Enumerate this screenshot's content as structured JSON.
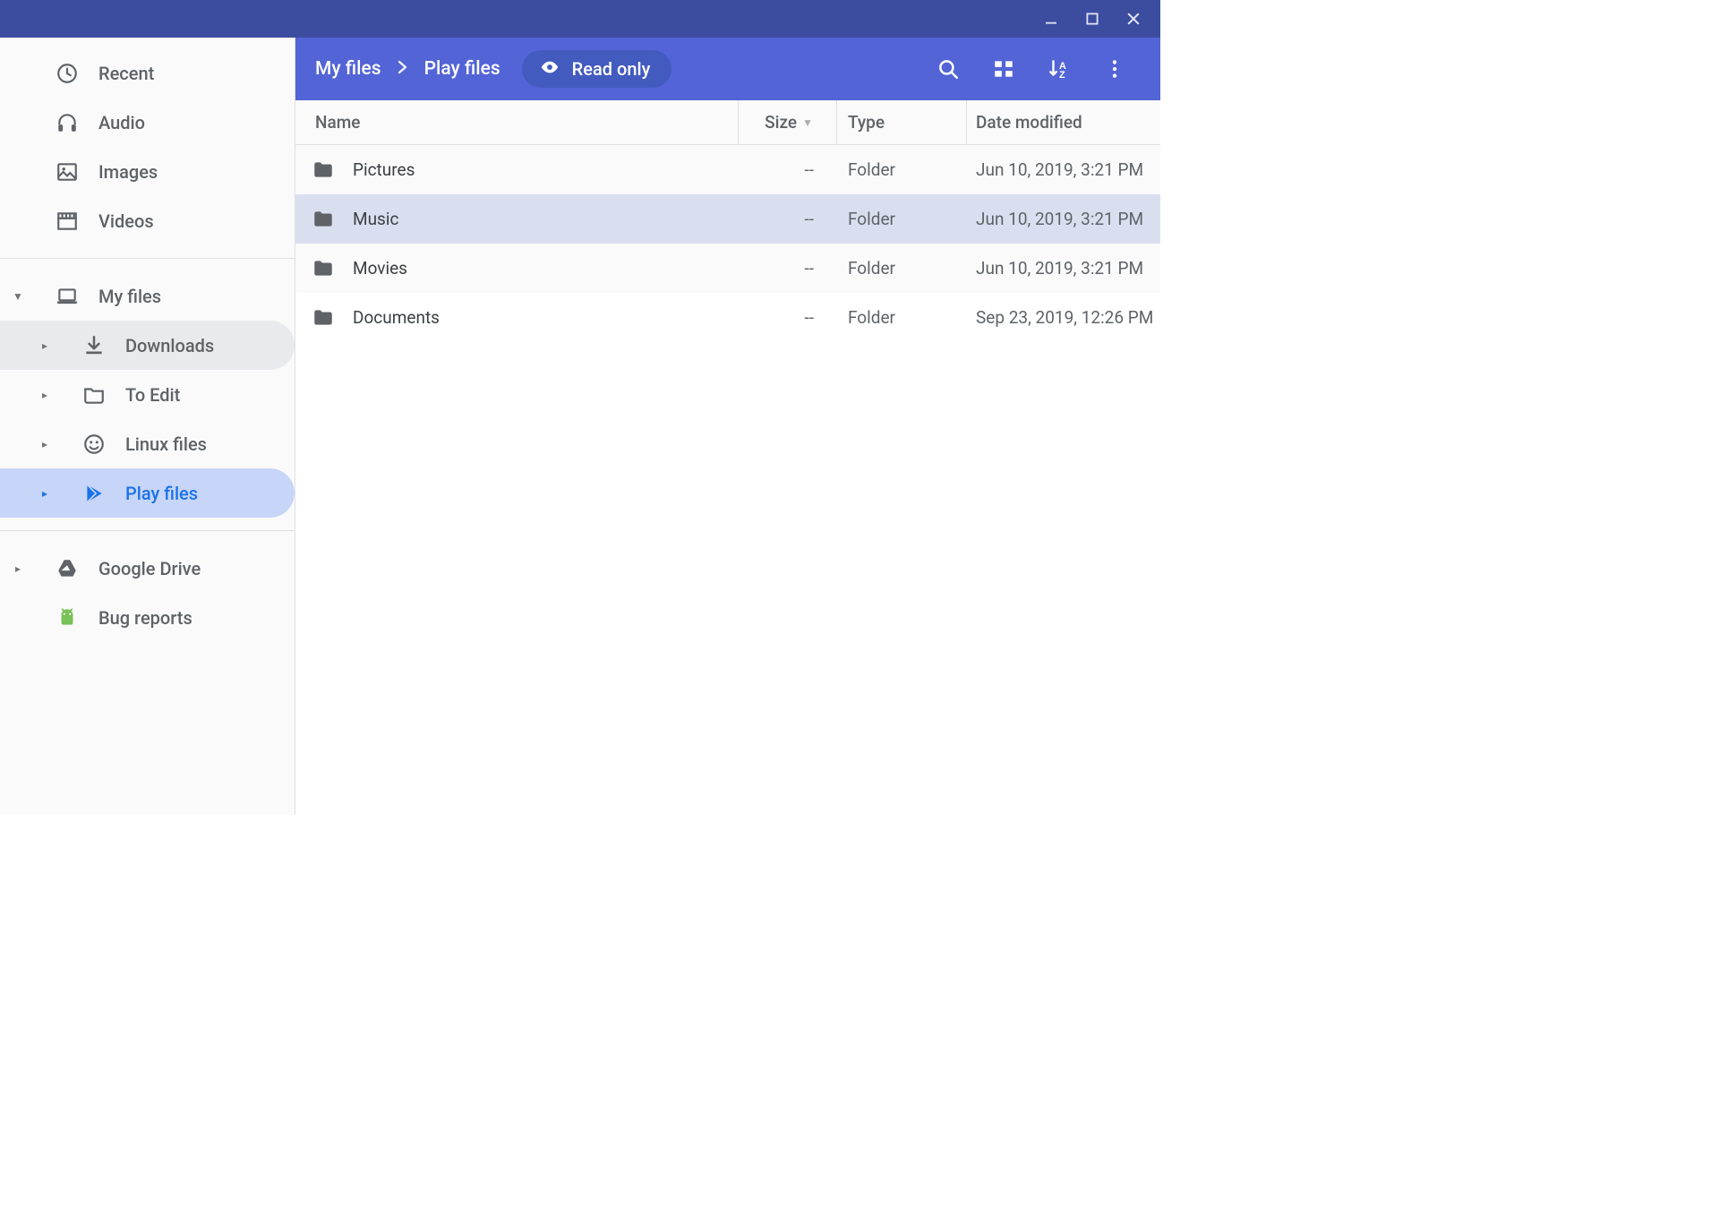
{
  "sidebar": {
    "quick": [
      {
        "id": "recent",
        "label": "Recent",
        "icon": "clock"
      },
      {
        "id": "audio",
        "label": "Audio",
        "icon": "headphones"
      },
      {
        "id": "images",
        "label": "Images",
        "icon": "image"
      },
      {
        "id": "videos",
        "label": "Videos",
        "icon": "clapper"
      }
    ],
    "myfiles": {
      "label": "My files",
      "children": [
        {
          "id": "downloads",
          "label": "Downloads",
          "icon": "download",
          "highlight": "light"
        },
        {
          "id": "to-edit",
          "label": "To Edit",
          "icon": "folder"
        },
        {
          "id": "linux",
          "label": "Linux files",
          "icon": "linux"
        },
        {
          "id": "play",
          "label": "Play files",
          "icon": "play",
          "highlight": "active"
        }
      ]
    },
    "drive": {
      "label": "Google Drive"
    },
    "bug": {
      "label": "Bug reports"
    }
  },
  "toolbar": {
    "crumbs": [
      "My files",
      "Play files"
    ],
    "readonly_label": "Read only"
  },
  "columns": {
    "name": "Name",
    "size": "Size",
    "type": "Type",
    "date": "Date modified"
  },
  "files": [
    {
      "name": "Pictures",
      "size": "--",
      "type": "Folder",
      "date": "Jun 10, 2019, 3:21 PM",
      "selected": false
    },
    {
      "name": "Music",
      "size": "--",
      "type": "Folder",
      "date": "Jun 10, 2019, 3:21 PM",
      "selected": true
    },
    {
      "name": "Movies",
      "size": "--",
      "type": "Folder",
      "date": "Jun 10, 2019, 3:21 PM",
      "selected": false
    },
    {
      "name": "Documents",
      "size": "--",
      "type": "Folder",
      "date": "Sep 23, 2019, 12:26 PM",
      "selected": false
    }
  ]
}
